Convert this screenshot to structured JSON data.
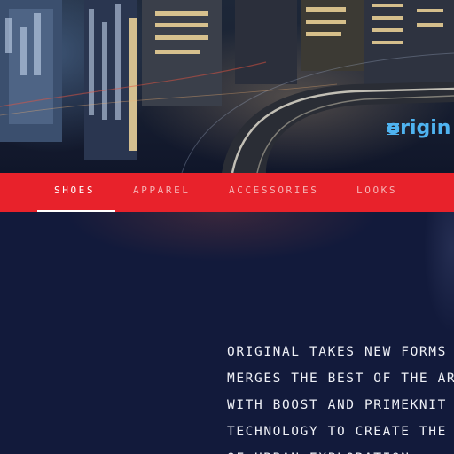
{
  "brand": {
    "logo_text": "origin"
  },
  "nav": {
    "items": [
      {
        "label": "SHOES",
        "active": true
      },
      {
        "label": "APPAREL",
        "active": false
      },
      {
        "label": "ACCESSORIES",
        "active": false
      },
      {
        "label": "LOOKS",
        "active": false
      }
    ]
  },
  "content": {
    "lines": [
      "ORIGINAL TAKES NEW FORMS",
      "MERGES THE BEST OF THE AR",
      "WITH BOOST AND PRIMEKNIT",
      "TECHNOLOGY TO CREATE THE",
      "OF URBAN EXPLORATION"
    ]
  },
  "colors": {
    "nav_bar": "#e8222b",
    "nav_active": "#ffffff",
    "nav_inactive": "#f6b3b4",
    "content_bg": "#121a3b",
    "logo": "#4fb3f0"
  }
}
